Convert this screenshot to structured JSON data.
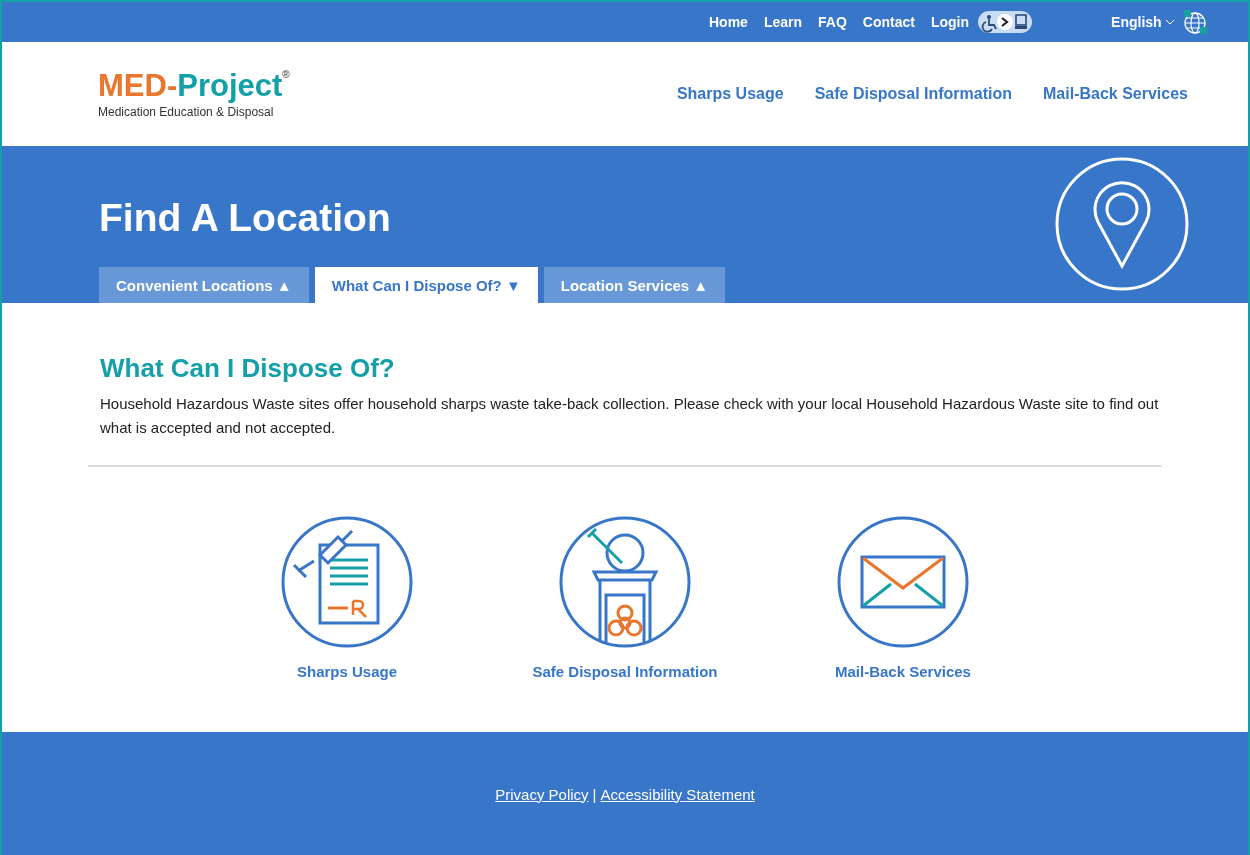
{
  "top_nav": {
    "links": [
      "Home",
      "Learn",
      "FAQ",
      "Contact",
      "Login"
    ],
    "language": "English"
  },
  "logo": {
    "first": "MED-",
    "second": "Project",
    "mark": "®",
    "tagline": "Medication Education & Disposal"
  },
  "main_nav": [
    "Sharps Usage",
    "Safe Disposal Information",
    "Mail-Back Services"
  ],
  "hero": {
    "title": "Find A Location",
    "tabs": [
      {
        "label": "Convenient Locations",
        "arrow": "▲",
        "selected": false
      },
      {
        "label": "What Can I Dispose Of?",
        "arrow": "▼",
        "selected": true
      },
      {
        "label": "Location Services",
        "arrow": "▲",
        "selected": false
      }
    ]
  },
  "section": {
    "heading": "What Can I Dispose Of?",
    "text": "Household Hazardous Waste sites offer household sharps waste take-back collection. Please check with your local Household Hazardous Waste site to find out what is accepted and not accepted."
  },
  "features": [
    {
      "kind": "sharps",
      "label": "Sharps Usage"
    },
    {
      "kind": "disposal",
      "label": "Safe Disposal Information"
    },
    {
      "kind": "mail",
      "label": "Mail-Back Services"
    }
  ],
  "footer": {
    "links": [
      "Privacy Policy",
      "Accessibility Statement"
    ],
    "separator": "|"
  }
}
